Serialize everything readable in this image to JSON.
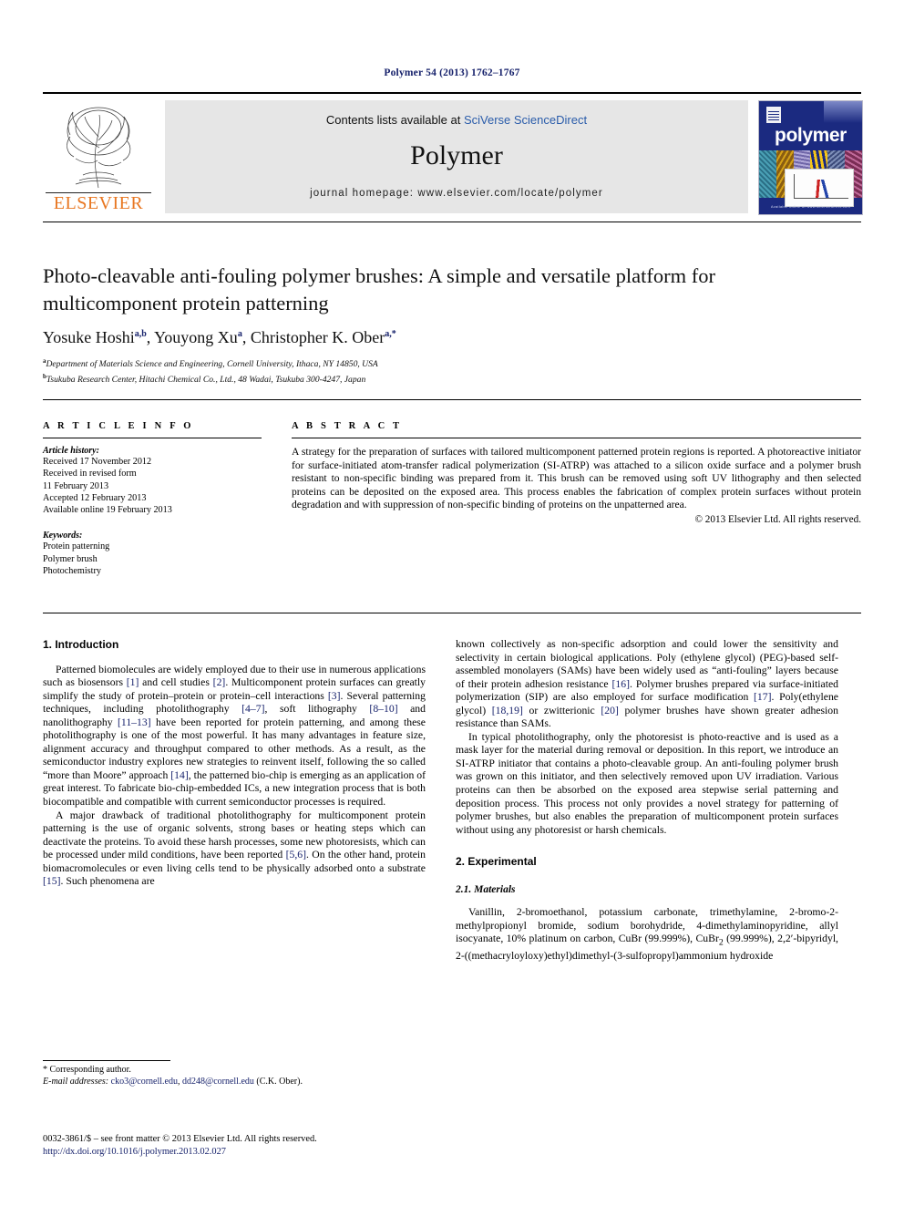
{
  "running_head": "Polymer 54 (2013) 1762–1767",
  "masthead": {
    "publisher_word": "ELSEVIER",
    "contents_prefix": "Contents lists available at ",
    "contents_link": "SciVerse ScienceDirect",
    "journal_name": "Polymer",
    "homepage": "journal homepage: www.elsevier.com/locate/polymer",
    "cover_title": "polymer",
    "cover_footer": "Available online at www.sciencedirect.com"
  },
  "article": {
    "title": "Photo-cleavable anti-fouling polymer brushes: A simple and versatile platform for multicomponent protein patterning",
    "authors": [
      {
        "name": "Yosuke Hoshi",
        "marks": "a,b",
        "sep": ", "
      },
      {
        "name": "Youyong Xu",
        "marks": "a",
        "sep": ", "
      },
      {
        "name": "Christopher K. Ober",
        "marks": "a,*",
        "sep": ""
      }
    ],
    "affiliations": [
      {
        "mark": "a",
        "text": "Department of Materials Science and Engineering, Cornell University, Ithaca, NY 14850, USA"
      },
      {
        "mark": "b",
        "text": "Tsukuba Research Center, Hitachi Chemical Co., Ltd., 48 Wadai, Tsukuba 300-4247, Japan"
      }
    ]
  },
  "info": {
    "heading": "A R T I C L E   I N F O",
    "history_label": "Article history:",
    "history": [
      "Received 17 November 2012",
      "Received in revised form",
      "11 February 2013",
      "Accepted 12 February 2013",
      "Available online 19 February 2013"
    ],
    "keywords_label": "Keywords:",
    "keywords": [
      "Protein patterning",
      "Polymer brush",
      "Photochemistry"
    ]
  },
  "abstract": {
    "heading": "A B S T R A C T",
    "text": "A strategy for the preparation of surfaces with tailored multicomponent patterned protein regions is reported. A photoreactive initiator for surface-initiated atom-transfer radical polymerization (SI-ATRP) was attached to a silicon oxide surface and a polymer brush resistant to non-specific binding was prepared from it. This brush can be removed using soft UV lithography and then selected proteins can be deposited on the exposed area. This process enables the fabrication of complex protein surfaces without protein degradation and with suppression of non-specific binding of proteins on the unpatterned area.",
    "copyright": "© 2013 Elsevier Ltd. All rights reserved."
  },
  "sections": {
    "introduction_heading": "1. Introduction",
    "experimental_heading": "2. Experimental",
    "materials_heading": "2.1. Materials"
  },
  "body": {
    "left_p1_a": "Patterned biomolecules are widely employed due to their use in numerous applications such as biosensors ",
    "left_p1_c1": "[1]",
    "left_p1_b": " and cell studies ",
    "left_p1_c2": "[2]",
    "left_p1_c": ". Multicomponent protein surfaces can greatly simplify the study of protein–protein or protein–cell interactions ",
    "left_p1_c3": "[3]",
    "left_p1_d": ". Several patterning techniques, including photolithography ",
    "left_p1_c4": "[4–7]",
    "left_p1_e": ", soft lithography ",
    "left_p1_c5": "[8–10]",
    "left_p1_f": " and nanolithography ",
    "left_p1_c6": "[11–13]",
    "left_p1_g": " have been reported for protein patterning, and among these photolithography is one of the most powerful. It has many advantages in feature size, alignment accuracy and throughput compared to other methods. As a result, as the semiconductor industry explores new strategies to reinvent itself, following the so called “more than Moore” approach ",
    "left_p1_c7": "[14]",
    "left_p1_h": ", the patterned bio-chip is emerging as an application of great interest. To fabricate bio-chip-embedded ICs, a new integration process that is both biocompatible and compatible with current semiconductor processes is required.",
    "left_p2_a": "A major drawback of traditional photolithography for multicomponent protein patterning is the use of organic solvents, strong bases or heating steps which can deactivate the proteins. To avoid these harsh processes, some new photoresists, which can be processed under mild conditions, have been reported ",
    "left_p2_c1": "[5,6]",
    "left_p2_b": ". On the other hand, protein biomacromolecules or even living cells tend to be physically adsorbed onto a substrate ",
    "left_p2_c2": "[15]",
    "left_p2_c": ". Such phenomena are",
    "right_p1_a": "known collectively as non-specific adsorption and could lower the sensitivity and selectivity in certain biological applications. Poly (ethylene glycol) (PEG)-based self-assembled monolayers (SAMs) have been widely used as “anti-fouling” layers because of their protein adhesion resistance ",
    "right_p1_c1": "[16]",
    "right_p1_b": ". Polymer brushes prepared via surface-initiated polymerization (SIP) are also employed for surface modification ",
    "right_p1_c2": "[17]",
    "right_p1_c": ". Poly(ethylene glycol) ",
    "right_p1_c3": "[18,19]",
    "right_p1_d": " or zwitterionic ",
    "right_p1_c4": "[20]",
    "right_p1_e": " polymer brushes have shown greater adhesion resistance than SAMs.",
    "right_p2": "In typical photolithography, only the photoresist is photo-reactive and is used as a mask layer for the material during removal or deposition. In this report, we introduce an SI-ATRP initiator that contains a photo-cleavable group. An anti-fouling polymer brush was grown on this initiator, and then selectively removed upon UV irradiation. Various proteins can then be absorbed on the exposed area stepwise serial patterning and deposition process. This process not only provides a novel strategy for patterning of polymer brushes, but also enables the preparation of multicomponent protein surfaces without using any photoresist or harsh chemicals.",
    "materials_a": "Vanillin, 2-bromoethanol, potassium carbonate, trimethylamine, 2-bromo-2-methylpropionyl bromide, sodium borohydride, 4-dimethylaminopyridine, allyl isocyanate, 10% platinum on carbon, CuBr (99.999%), CuBr",
    "materials_sub": "2",
    "materials_b": " (99.999%), 2,2′-bipyridyl, 2-((methacryloyloxy)ethyl)dimethyl-(3-sulfopropyl)ammonium hydroxide"
  },
  "footer": {
    "corresponding_marker": "*",
    "corresponding_text": " Corresponding author.",
    "email_label": "E-mail addresses:",
    "email1": "cko3@cornell.edu",
    "email_sep": ", ",
    "email2": "dd248@cornell.edu",
    "email_suffix": " (C.K. Ober).",
    "imprint": "0032-3861/$ – see front matter © 2013 Elsevier Ltd. All rights reserved.",
    "doi": "http://dx.doi.org/10.1016/j.polymer.2013.02.027"
  }
}
